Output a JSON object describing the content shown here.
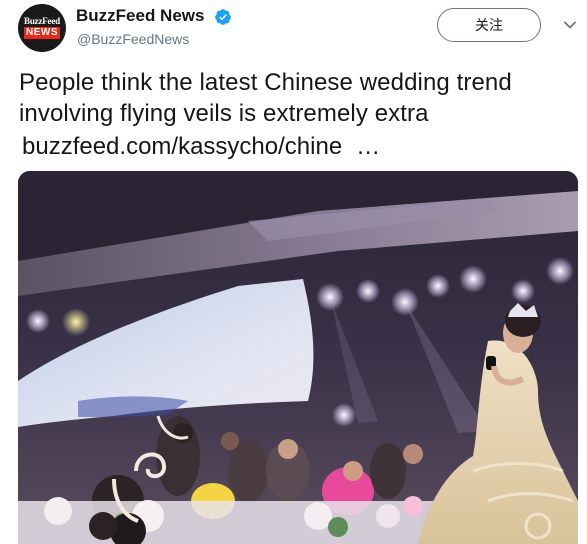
{
  "account": {
    "display_name": "BuzzFeed News",
    "handle": "@BuzzFeedNews",
    "avatar_top": "BuzzFeed",
    "avatar_bottom": "NEWS",
    "verified": true
  },
  "follow_button": {
    "label": "关注"
  },
  "tweet": {
    "text_line_1": "People think the latest Chinese wedding trend",
    "text_line_2": "involving flying veils is extremely extra",
    "link": "buzzfeed.com/kassycho/chine",
    "link_ellipsis": "…"
  },
  "colors": {
    "text": "#14171a",
    "secondary": "#657786",
    "verified_blue": "#1da1f2",
    "brand_red": "#e32a1d"
  }
}
